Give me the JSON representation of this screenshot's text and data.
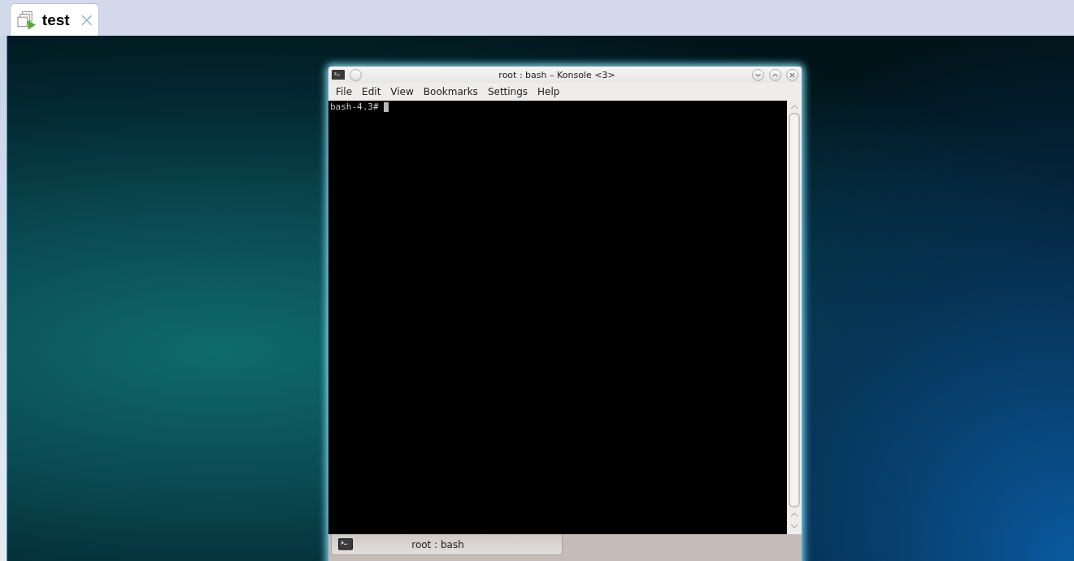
{
  "tab": {
    "label": "test",
    "selected": true
  },
  "window": {
    "title": "root : bash – Konsole <3>",
    "menu": [
      "File",
      "Edit",
      "View",
      "Bookmarks",
      "Settings",
      "Help"
    ],
    "terminal": {
      "prompt": "bash-4.3#"
    },
    "session_tabs": [
      {
        "label": "root : bash",
        "selected": true
      }
    ]
  }
}
